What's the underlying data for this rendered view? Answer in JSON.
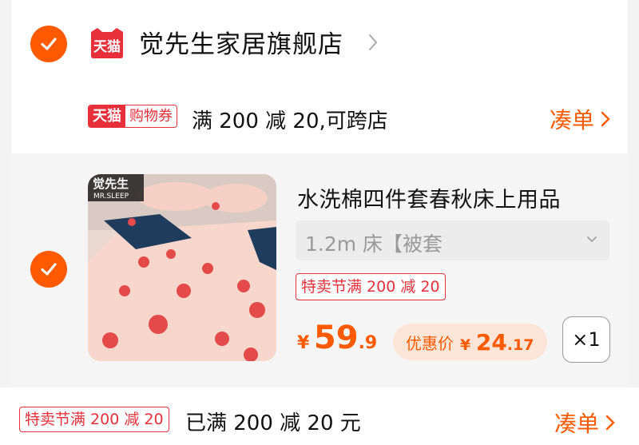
{
  "store": {
    "logo_text": "天猫",
    "name": "觉先生家居旗舰店"
  },
  "coupon": {
    "badge_brand": "天猫",
    "badge_type": "购物券",
    "text": "满 200 减 20,可跨店",
    "action": "凑单"
  },
  "item": {
    "image_brand": "觉先生",
    "image_brand_sub": "MR.SLEEP",
    "title": "水洗棉四件套春秋床上用品",
    "sku": "1.2m 床【被套",
    "promo": "特卖节满 200 减 20",
    "price": {
      "symbol": "¥",
      "integer": "59",
      "decimal": ".9"
    },
    "discount": {
      "label": "优惠价",
      "symbol": "¥",
      "integer": "24",
      "decimal": ".17"
    },
    "quantity": "×1"
  },
  "footer": {
    "promo": "特卖节满 200 减 20",
    "status": "已满 200 减 20 元",
    "action": "凑单"
  },
  "colors": {
    "accent": "#ff5a00",
    "tmall_red": "#e8303a"
  }
}
